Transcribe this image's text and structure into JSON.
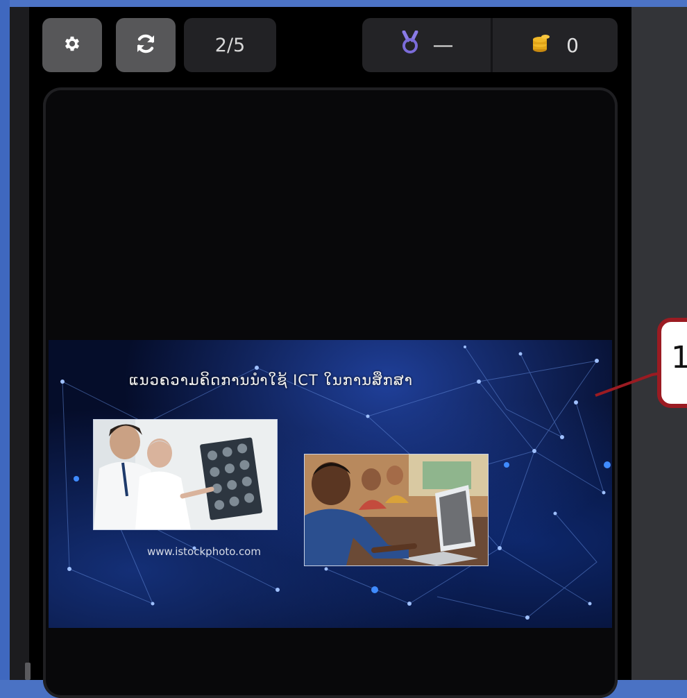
{
  "toolbar": {
    "settings_icon": "gear-icon",
    "refresh_icon": "refresh-icon",
    "page_indicator": "2/5",
    "medal_icon": "medal-icon",
    "medal_value": "—",
    "coins_icon": "coins-icon",
    "coins_value": "0"
  },
  "slide": {
    "title": "ແນວຄວາມຄິດການນຳໃຊ້ ICT ໃນການສຶກສາ",
    "image_credit": "www.istockphoto.com"
  },
  "callout": {
    "label": "1"
  },
  "colors": {
    "outer_background": "#4a72c4",
    "panel": "#000000",
    "button": "#575759",
    "accent_medal": "#7b6cd9",
    "accent_coins": "#e0a418",
    "callout_border": "#9b1b22"
  }
}
